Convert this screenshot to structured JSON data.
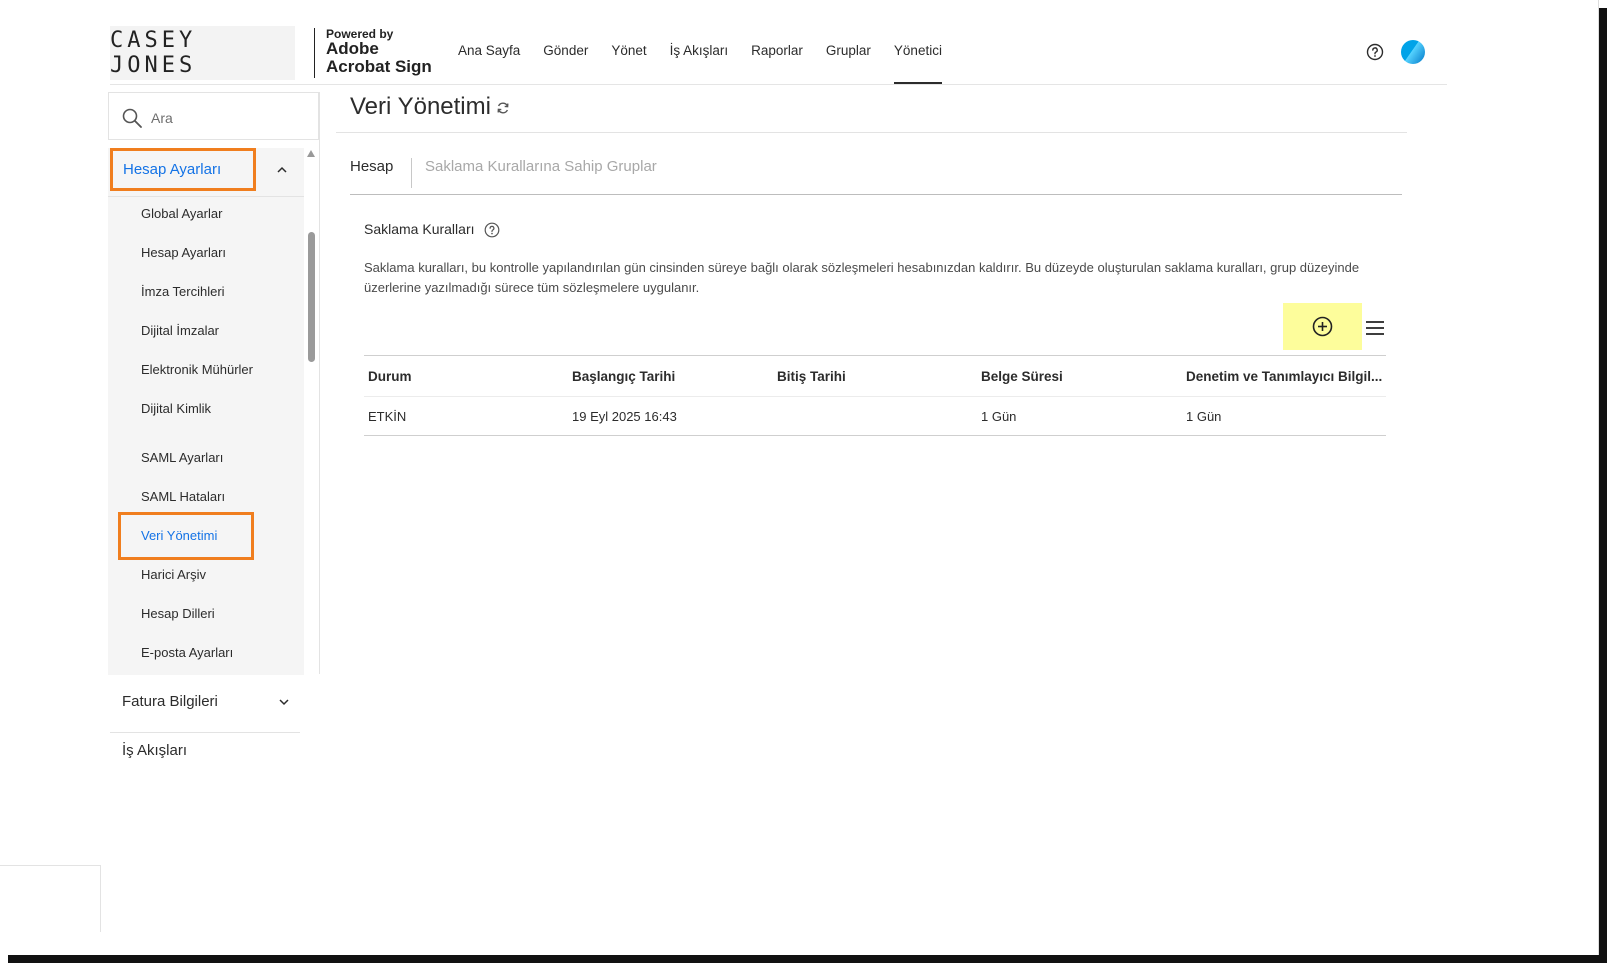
{
  "header": {
    "logo": "CASEY JONES",
    "powered_by": "Powered by",
    "brand_line1": "Adobe",
    "brand_line2": "Acrobat Sign",
    "nav": [
      "Ana Sayfa",
      "Gönder",
      "Yönet",
      "İş Akışları",
      "Raporlar",
      "Gruplar",
      "Yönetici"
    ],
    "active_nav": "Yönetici"
  },
  "sidebar": {
    "search_placeholder": "Ara",
    "section": "Hesap Ayarları",
    "items": [
      "Global Ayarlar",
      "Hesap Ayarları",
      "İmza Tercihleri",
      "Dijital İmzalar",
      "Elektronik Mühürler",
      "Dijital Kimlik",
      "SAML Ayarları",
      "SAML Hataları",
      "Veri Yönetimi",
      "Harici Arşiv",
      "Hesap Dilleri",
      "E-posta Ayarları"
    ],
    "active_item": "Veri Yönetimi",
    "collapsed_sections": [
      "Fatura Bilgileri",
      "İş Akışları"
    ]
  },
  "main": {
    "title": "Veri Yönetimi",
    "tabs": [
      "Hesap",
      "Saklama Kurallarına Sahip Gruplar"
    ],
    "section_title": "Saklama Kuralları",
    "description": "Saklama kuralları, bu kontrolle yapılandırılan gün cinsinden süreye bağlı olarak sözleşmeleri hesabınızdan kaldırır. Bu düzeyde oluşturulan saklama kuralları, grup düzeyinde üzerlerine yazılmadığı sürece tüm sözleşmelere uygulanır.",
    "table": {
      "headers": [
        "Durum",
        "Başlangıç Tarihi",
        "Bitiş Tarihi",
        "Belge Süresi",
        "Denetim ve Tanımlayıcı Bilgil..."
      ],
      "rows": [
        [
          "ETKİN",
          "19 Eyl 2025 16:43",
          "",
          "1 Gün",
          "1 Gün"
        ]
      ]
    }
  },
  "colors": {
    "accent_blue": "#1473e6",
    "highlight_orange": "#f07e1e",
    "highlight_yellow": "#fdfd9b"
  }
}
